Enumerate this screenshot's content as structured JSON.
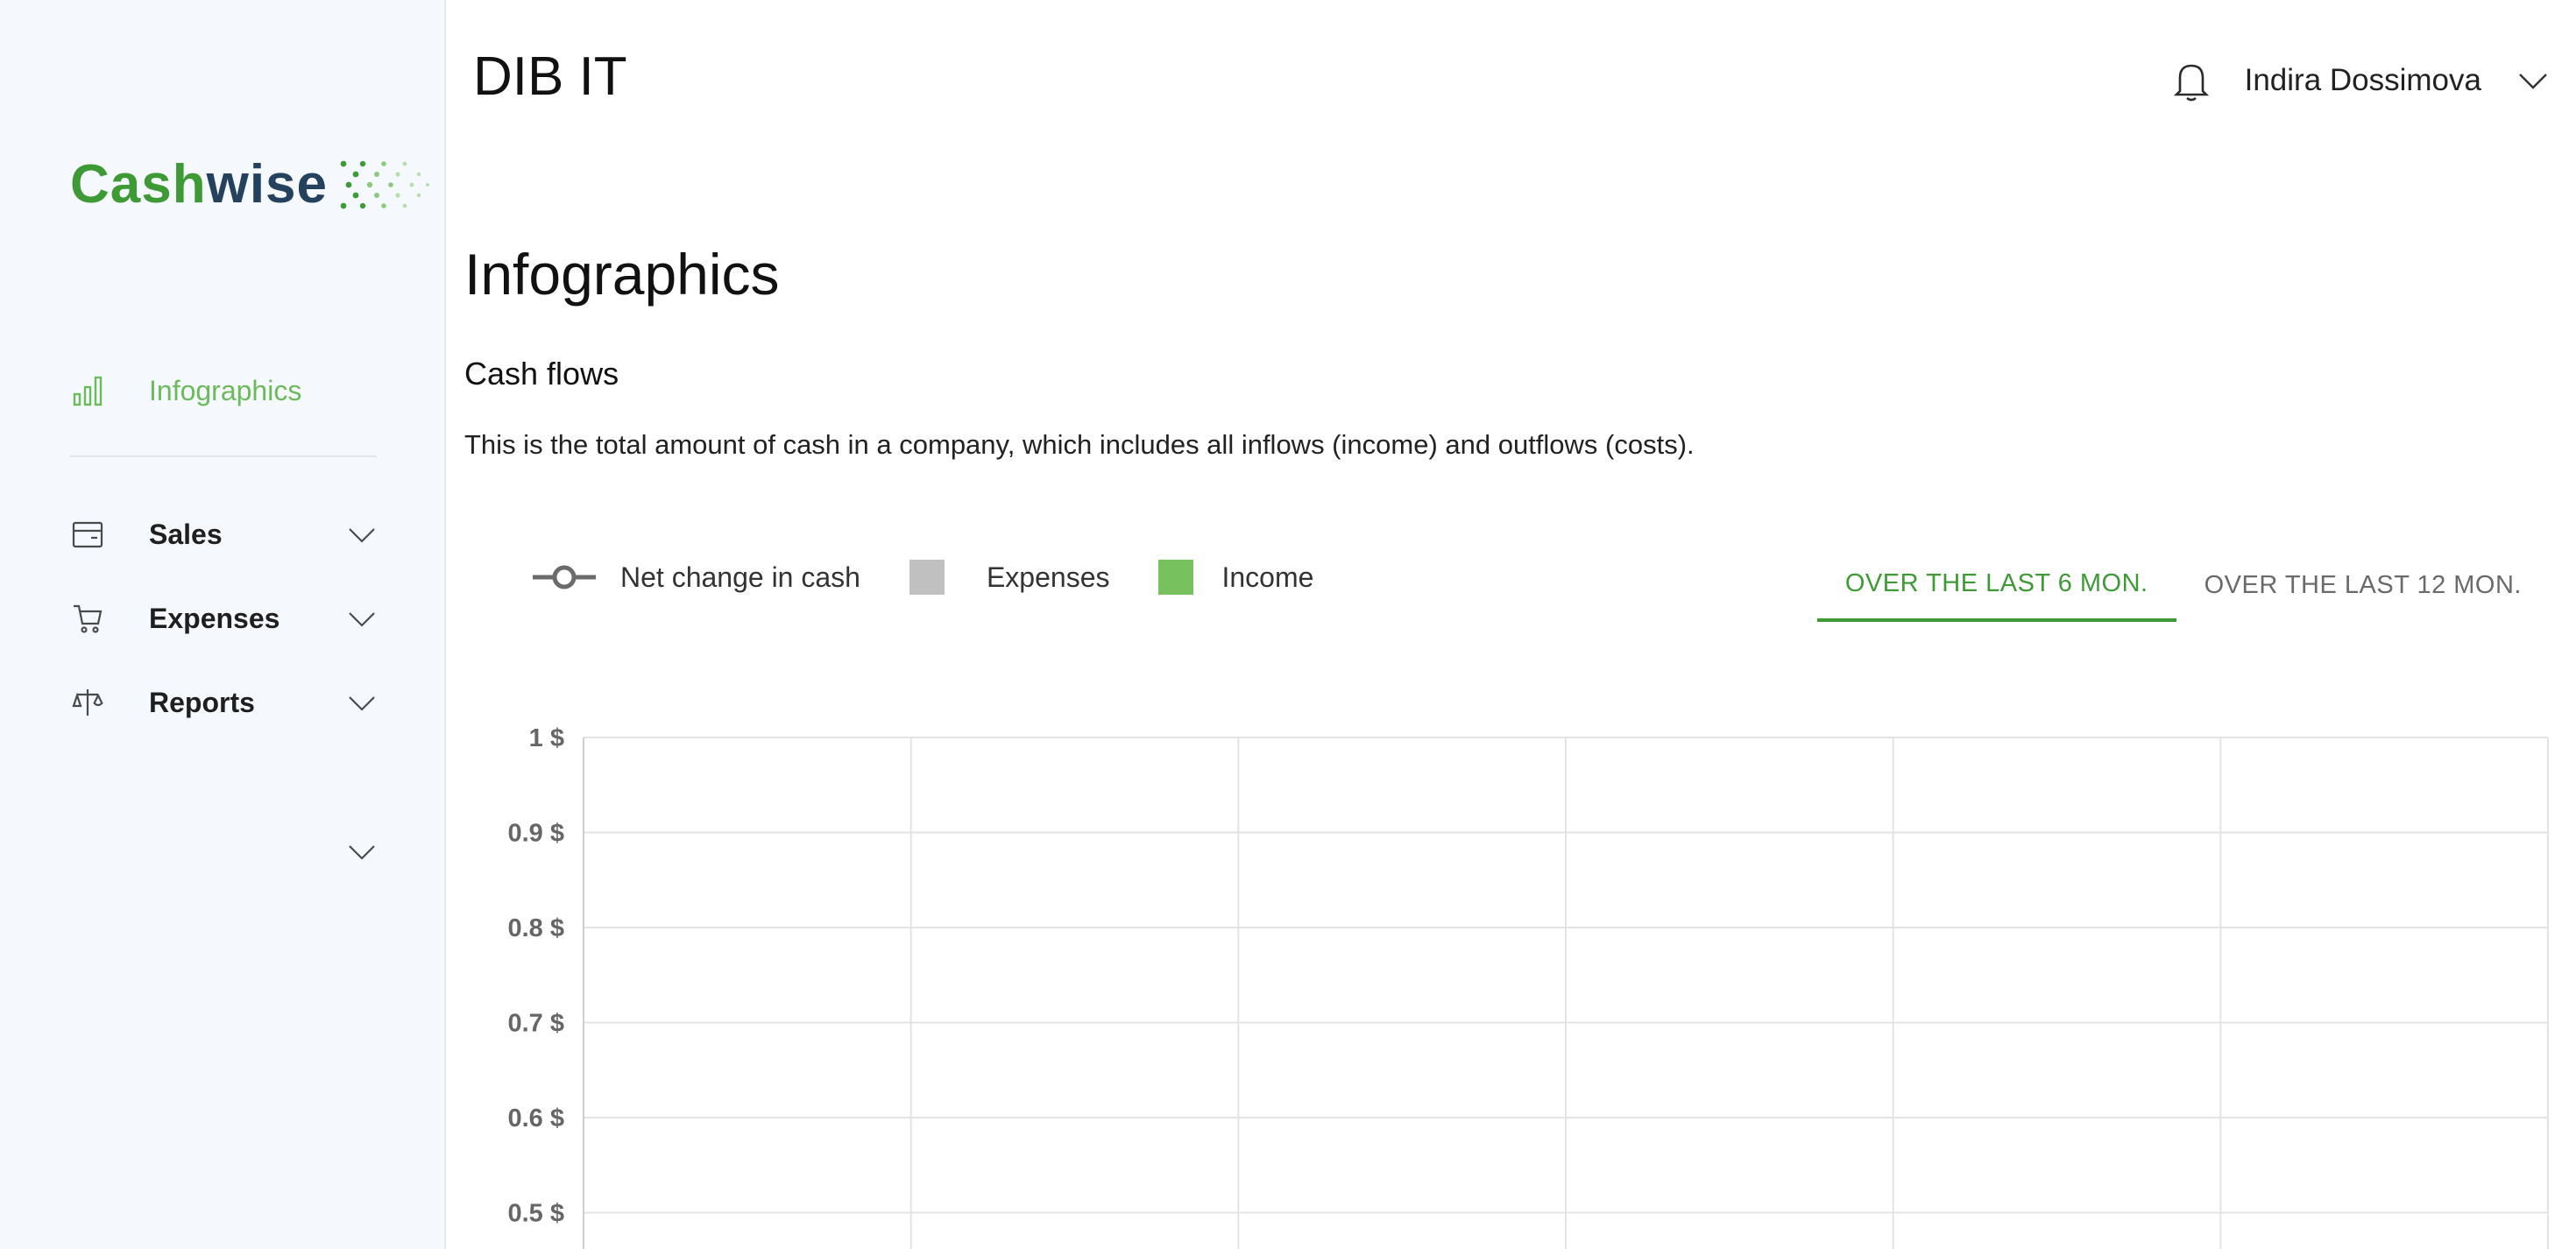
{
  "app": {
    "brand_part1": "Cash",
    "brand_part2": "wise",
    "company": "DIB IT",
    "user_name": "Indira Dossimova"
  },
  "sidebar": {
    "items": [
      {
        "label": "Infographics",
        "icon": "bar-chart-icon",
        "active": true
      },
      {
        "label": "Sales",
        "icon": "wallet-icon"
      },
      {
        "label": "Expenses",
        "icon": "cart-icon"
      },
      {
        "label": "Reports",
        "icon": "scales-icon"
      },
      {
        "label": ""
      }
    ]
  },
  "page": {
    "title": "Infographics",
    "section_title": "Cash flows",
    "section_desc": "This is the total amount of cash in a company, which includes all inflows (income) and outflows (costs)."
  },
  "legend": [
    {
      "label": "Net change in cash",
      "type": "line",
      "color": "#6b6b6b"
    },
    {
      "label": "Expenses",
      "type": "swatch",
      "color": "#c0c0c0"
    },
    {
      "label": "Income",
      "type": "swatch",
      "color": "#77c15f"
    }
  ],
  "tabs": [
    {
      "label": "OVER THE LAST 6 MON.",
      "active": true
    },
    {
      "label": "OVER THE LAST 12 MON.",
      "active": false
    }
  ],
  "colors": {
    "accent": "#3e9a35",
    "accent_light": "#6cbb5a",
    "grid": "#e3e3e3"
  },
  "chart_data": {
    "type": "bar",
    "y_ticks": [
      "1 $",
      "0.9 $",
      "0.8 $",
      "0.7 $",
      "0.6 $",
      "0.5 $"
    ],
    "y_tick_values": [
      1,
      0.9,
      0.8,
      0.7,
      0.6,
      0.5
    ],
    "column_count": 6,
    "series": [],
    "grid": true
  }
}
